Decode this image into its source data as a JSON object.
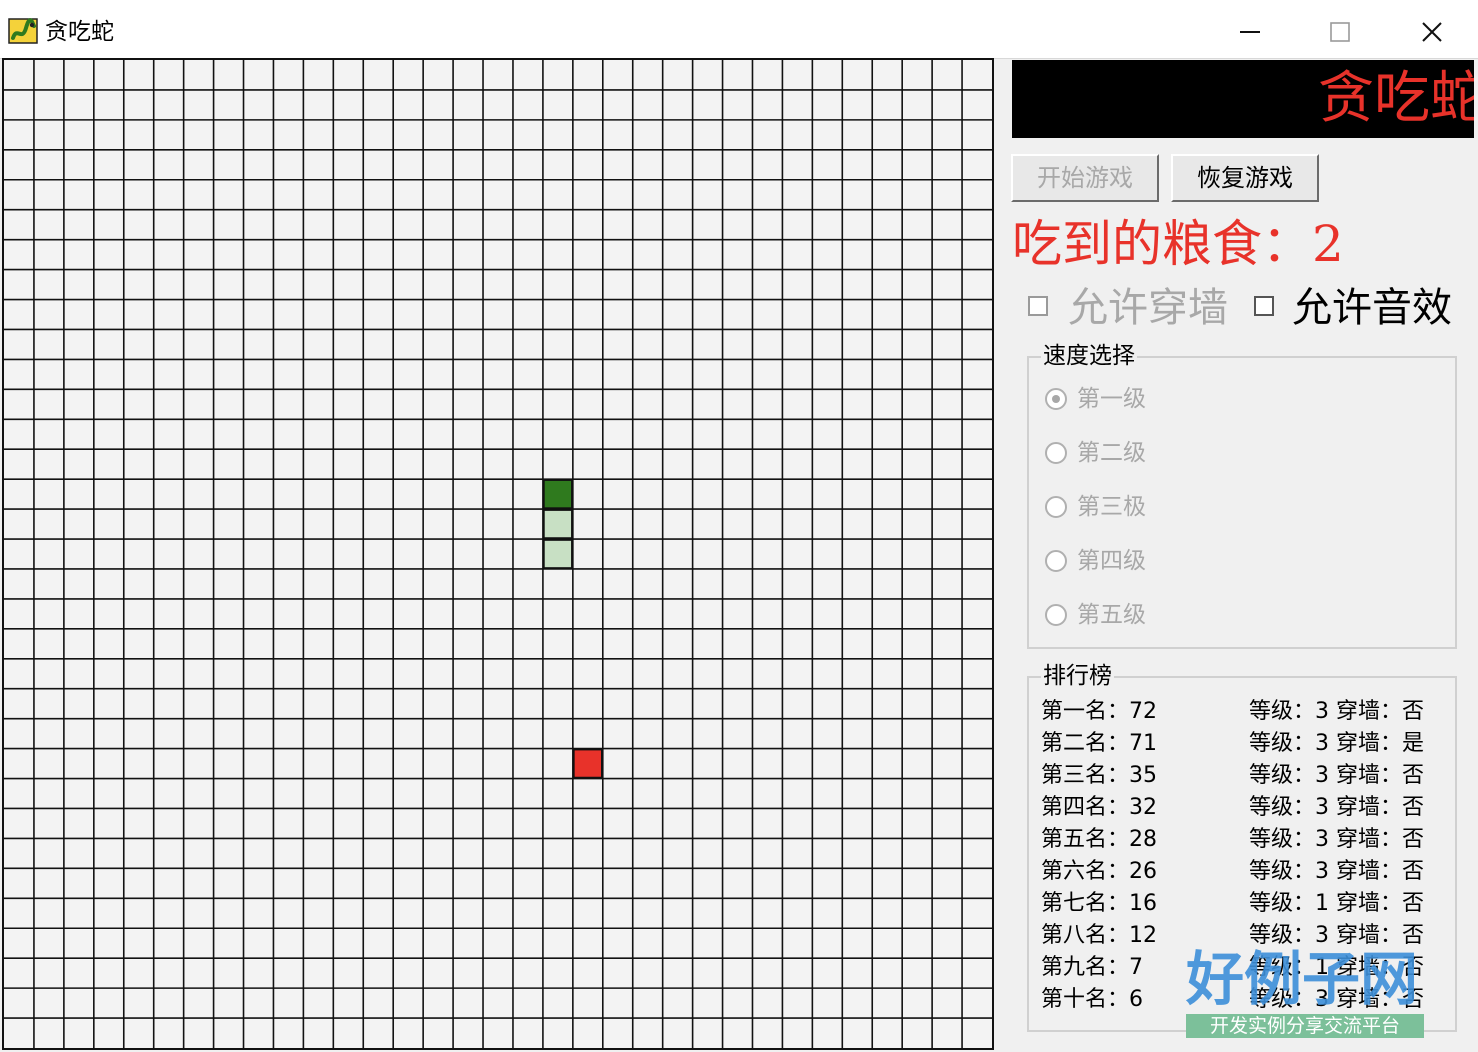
{
  "window": {
    "title": "贪吃蛇",
    "icons": {
      "app": "snake-app-icon",
      "minimize": "minimize-icon",
      "maximize": "maximize-icon",
      "close": "close-icon"
    }
  },
  "board": {
    "cols": 33,
    "rows": 33,
    "grid_color": "#111111",
    "background": "#f3f3f3",
    "snake": [
      {
        "col": 18,
        "row": 14,
        "kind": "head"
      },
      {
        "col": 18,
        "row": 15,
        "kind": "body"
      },
      {
        "col": 18,
        "row": 16,
        "kind": "body"
      }
    ],
    "food": {
      "col": 19,
      "row": 23
    },
    "colors": {
      "head": "#2f7a1e",
      "body": "#c8e0c4",
      "food": "#e8322a"
    }
  },
  "panel": {
    "banner_text": "贪吃蛇",
    "start_button": "开始游戏",
    "resume_button": "恢复游戏",
    "score_label": "吃到的粮食：",
    "score_value": "2",
    "allow_wall": "允许穿墙",
    "allow_sound": "允许音效",
    "accent_color": "#e8322a"
  },
  "speed": {
    "title": "速度选择",
    "options": [
      "第一级",
      "第二级",
      "第三极",
      "第四级",
      "第五级"
    ],
    "selected": 0
  },
  "ranking": {
    "title": "排行榜",
    "rows": [
      {
        "name": "第一名：72",
        "info": "等级：3 穿墙：否"
      },
      {
        "name": "第二名：71",
        "info": "等级：3 穿墙：是"
      },
      {
        "name": "第三名：35",
        "info": "等级：3 穿墙：否"
      },
      {
        "name": "第四名：32",
        "info": "等级：3 穿墙：否"
      },
      {
        "name": "第五名：28",
        "info": "等级：3 穿墙：否"
      },
      {
        "name": "第六名：26",
        "info": "等级：3 穿墙：否"
      },
      {
        "name": "第七名：16",
        "info": "等级：1 穿墙：否"
      },
      {
        "name": "第八名：12",
        "info": "等级：3 穿墙：否"
      },
      {
        "name": "第九名：7",
        "info": "等级：1 穿墙：否"
      },
      {
        "name": "第十名：6",
        "info": "等级：3 穿墙：否"
      }
    ]
  },
  "watermark": {
    "title": "好例子网",
    "subtitle": "开发实例分享交流平台"
  }
}
